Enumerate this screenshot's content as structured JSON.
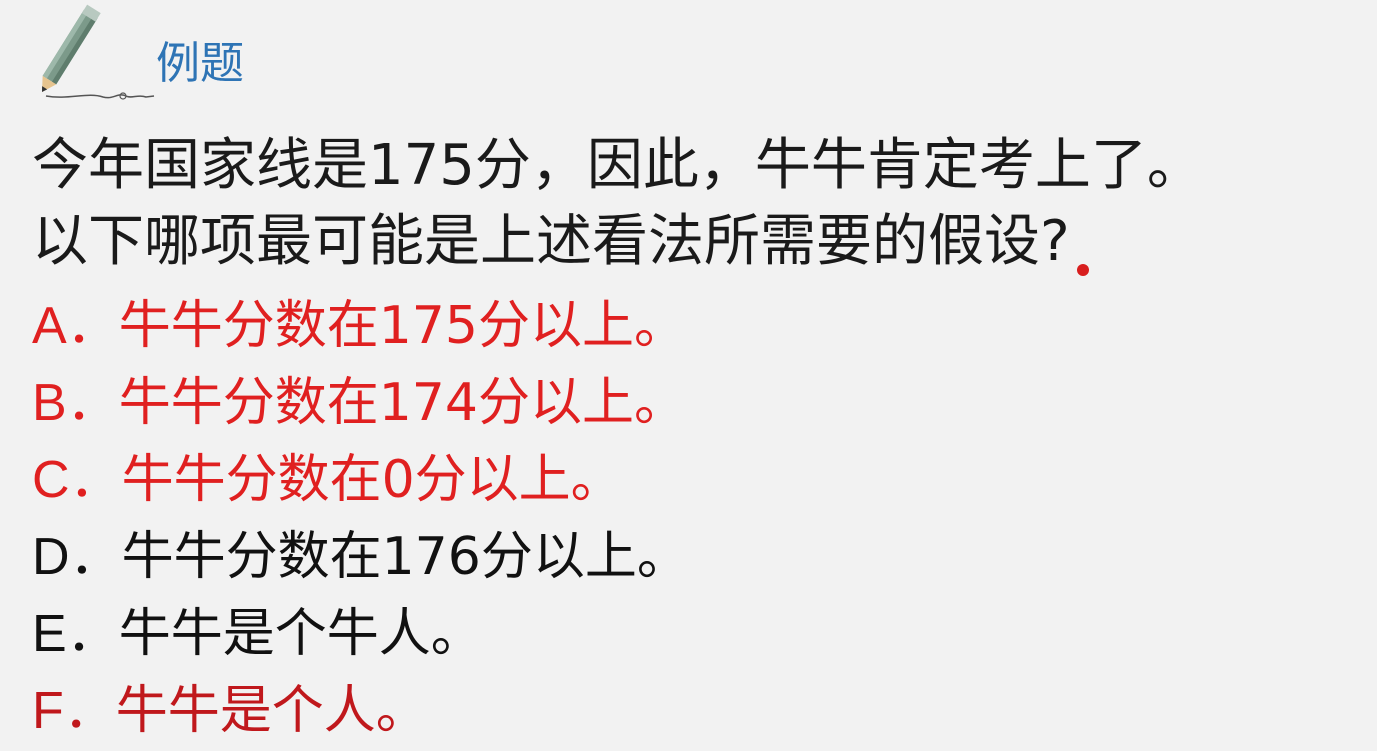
{
  "header": {
    "title": "例题",
    "icon": "pencil-icon"
  },
  "question": {
    "line1": "今年国家线是175分，因此，牛牛肯定考上了。",
    "line2": "以下哪项最可能是上述看法所需要的假设?"
  },
  "options": [
    {
      "letter": "A．",
      "text": "牛牛分数在175分以上。",
      "color": "#e02020"
    },
    {
      "letter": "B．",
      "text": "牛牛分数在174分以上。",
      "color": "#e02020"
    },
    {
      "letter": "C．",
      "text": "牛牛分数在0分以上。",
      "color": "#e02020"
    },
    {
      "letter": "D．",
      "text": "牛牛分数在176分以上。",
      "color": "#111111"
    },
    {
      "letter": "E．",
      "text": "牛牛是个牛人。",
      "color": "#111111"
    },
    {
      "letter": "F．",
      "text": "牛牛是个人。",
      "color": "#c0181c"
    }
  ]
}
